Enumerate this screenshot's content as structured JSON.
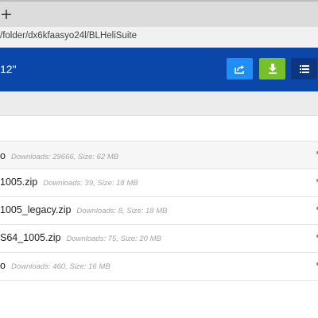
{
  "browser": {
    "new_tab_label": "+",
    "url": "/folder/dx6kfaasyo24l/BLHeliSuite"
  },
  "header": {
    "title": "12\"",
    "buttons": {
      "share_icon": "share-icon",
      "download_icon": "download-icon",
      "list_icon": "list-view-icon"
    },
    "colors": {
      "header_bg": "#0a47a8",
      "share_bg": "#1e8ff7",
      "download_bg": "#78c02a",
      "list_bg": "#0d3580"
    }
  },
  "files": [
    {
      "name": "o",
      "meta": "Downloads: 29666, Size: 62 MB"
    },
    {
      "name": "1005.zip",
      "meta": "Downloads: 39, Size: 18 MB"
    },
    {
      "name": "1005_legacy.zip",
      "meta": "Downloads: 8, Size: 18 MB"
    },
    {
      "name": "S64_1005.zip",
      "meta": "Downloads: 75, Size: 20 MB"
    },
    {
      "name": "o",
      "meta": "Downloads: 460, Size: 16 MB"
    }
  ]
}
